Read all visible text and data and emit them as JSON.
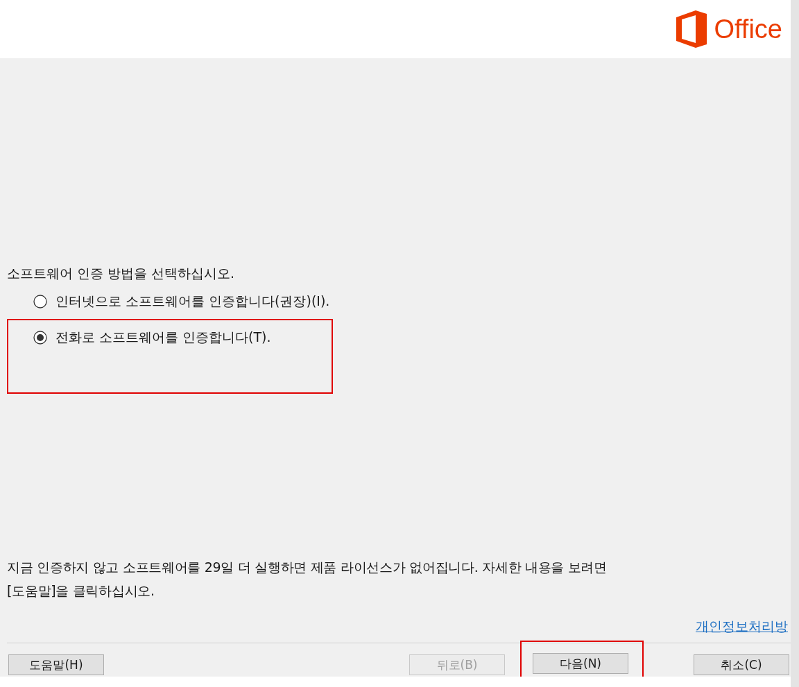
{
  "header": {
    "brand": "Office"
  },
  "prompt": "소프트웨어 인증 방법을 선택하십시오.",
  "options": [
    {
      "label": "인터넷으로 소프트웨어를 인증합니다(권장)(I).",
      "selected": false,
      "highlighted": false
    },
    {
      "label": "전화로 소프트웨어를 인증합니다(T).",
      "selected": true,
      "highlighted": true
    }
  ],
  "notice_lines": [
    "지금 인증하지 않고 소프트웨어를 29일 더 실행하면 제품 라이선스가 없어집니다. 자세한 내용을 보려면",
    "[도움말]을 클릭하십시오."
  ],
  "privacy_link": "개인정보처리방",
  "buttons": [
    {
      "label": "도움말(H)",
      "disabled": false,
      "highlighted": false
    },
    {
      "label": "뒤로(B)",
      "disabled": true,
      "highlighted": false
    },
    {
      "label": "다음(N)",
      "disabled": false,
      "highlighted": true
    },
    {
      "label": "취소(C)",
      "disabled": false,
      "highlighted": false
    }
  ]
}
